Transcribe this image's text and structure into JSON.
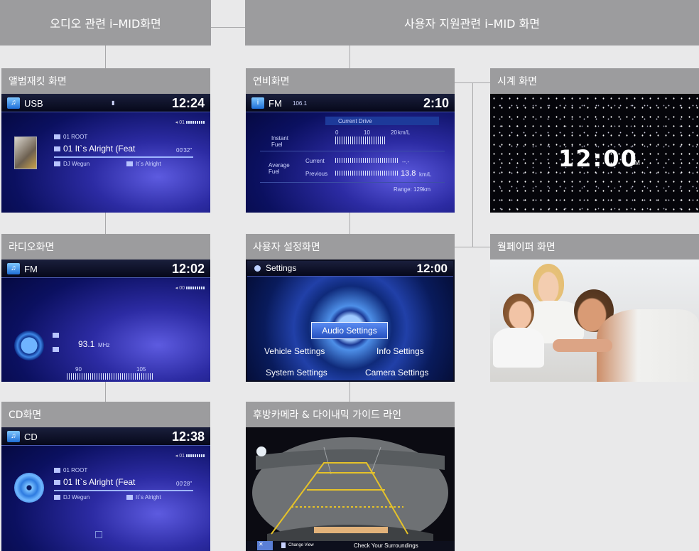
{
  "categories": {
    "audio": "오디오 관련 i–MID화면",
    "user": "사용자 지원관련 i–MID 화면"
  },
  "panels": {
    "album": {
      "title": "앨범재킷 화면",
      "source": "USB",
      "clock": "12:24",
      "vol": "01",
      "folder": "01   ROOT",
      "track": "01 It`s Alright (Feat",
      "elapsed": "00'32\"",
      "artist": "DJ Wegun",
      "album": "It`s Alright"
    },
    "fuel": {
      "title": "연비화면",
      "source": "FM",
      "freq": "106.1",
      "clock": "2:10",
      "mode": "Current Drive",
      "instant_label": "Instant\nFuel",
      "scale": [
        "0",
        "10",
        "20"
      ],
      "unit": "km/L",
      "average_label": "Average\nFuel",
      "current_label": "Current",
      "previous_label": "Previous",
      "current_value": "--.-",
      "previous_value": "13.8",
      "previous_unit": "km/L",
      "range": "Range: 129km"
    },
    "clock": {
      "title": "시계 화면",
      "time": "12:00",
      "ampm": "AM"
    },
    "radio": {
      "title": "라디오화면",
      "source": "FM",
      "clock": "12:02",
      "vol": "00",
      "freq": "93.1",
      "unit": "MHz",
      "scale": [
        "90",
        "105"
      ]
    },
    "settings": {
      "title": "사용자 설정화면",
      "header": "Settings",
      "clock": "12:00",
      "audio": "Audio Settings",
      "vehicle": "Vehicle Settings",
      "info": "Info Settings",
      "system": "System Settings",
      "camera": "Camera Settings"
    },
    "wallpaper": {
      "title": "월페이퍼 화면"
    },
    "cd": {
      "title": "CD화면",
      "source": "CD",
      "clock": "12:38",
      "vol": "01",
      "folder": "01   ROOT",
      "track": "01 It`s Alright (Feat",
      "elapsed": "00'28\"",
      "artist": "DJ Wegun",
      "album": "It`s Alright"
    },
    "camera": {
      "title": "후방카메라 & 다이내믹 가이드 라인",
      "change": "Change View",
      "check": "Check Your Surroundings"
    }
  },
  "colors": {
    "background": "#e9e9ea",
    "header_gray": "#9c9c9e",
    "guide_yellow": "#e5c229"
  }
}
